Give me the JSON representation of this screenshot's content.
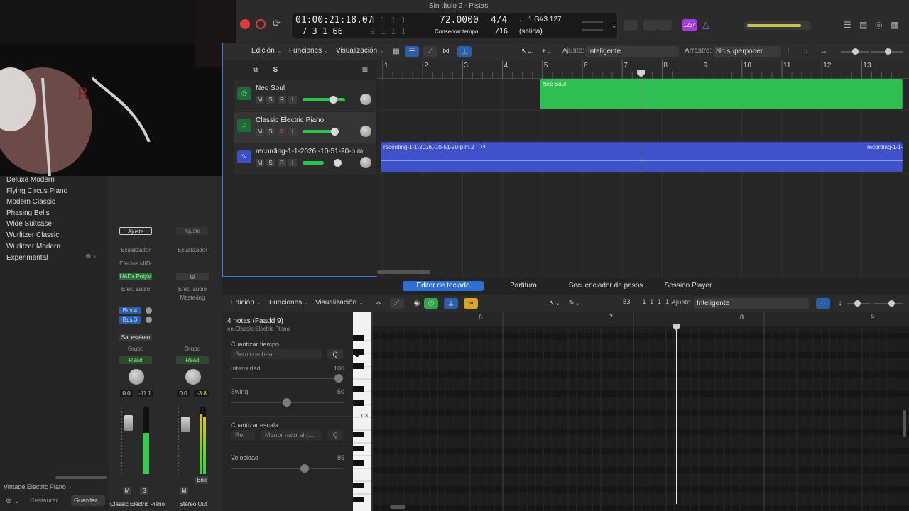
{
  "window": {
    "title": "Sin título 2 - Pistas"
  },
  "lcd": {
    "time": "01:00:21:18.07",
    "bars_dim": "1  1  1    1",
    "bars": "7  3  1    66",
    "bars2_dim": "9  1  1    1",
    "tempo": "72.0000",
    "tempo_mode": "Conservar tempo",
    "signature": "4/4",
    "division": "/16",
    "note": "♩ 1  G#3  127",
    "output": "(salida)",
    "count_in": "1234"
  },
  "library": {
    "items": [
      "Deluxe Modern",
      "Flying Circus Piano",
      "Modern Classic",
      "Phasing Bells",
      "Wide Suitcase",
      "Wurlitzer Classic",
      "Wurlitzer Modern",
      "Experimental"
    ],
    "patch": "Vintage Electric Piano",
    "restore": "Restaurar",
    "save": "Guardar..."
  },
  "mixer": {
    "strip1": {
      "setting": "Ajuste",
      "eq": "Ecualizador",
      "midi_fx": "Efectos MIDI",
      "plugin": "UADx PolyM",
      "audio_fx": "Efec. audio",
      "bus1": "Bus 4",
      "bus2": "Bus 3",
      "output": "Sal estéreo",
      "group": "Grupo",
      "auto": "Read",
      "pan": "0.0",
      "vol": "-11.1",
      "mute": "M",
      "solo": "S",
      "name": "Classic Electric Piano"
    },
    "strip2": {
      "setting": "Ajuste",
      "eq": "Ecualizador",
      "audio_fx": "Efec. audio",
      "mastering": "Mastering",
      "group": "Grupo",
      "auto": "Read",
      "pan": "0.0",
      "vol": "-3.8",
      "bnc": "Bnc",
      "mute": "M",
      "name": "Stereo Out"
    }
  },
  "track_toolbar": {
    "edit": "Edición",
    "functions": "Funciones",
    "view": "Visualización",
    "snap_label": "Ajuste:",
    "snap_value": "Inteligente",
    "drag_label": "Arrastre:",
    "drag_value": "No superponer"
  },
  "ruler": [
    "1",
    "2",
    "3",
    "4",
    "5",
    "6",
    "7",
    "8",
    "9",
    "10",
    "11",
    "12",
    "13"
  ],
  "tracks": [
    {
      "name": "Neo Soul",
      "m": "M",
      "s": "S",
      "r": "R",
      "i": "I"
    },
    {
      "name": "Classic Electric Piano",
      "m": "M",
      "s": "S",
      "r": "R",
      "i": "I"
    },
    {
      "name": "recording-1-1-2026,-10-51-20-p.m.",
      "m": "M",
      "s": "S",
      "r": "R",
      "i": "I"
    }
  ],
  "regions": {
    "neo": "Neo Soul",
    "audio": "recording-1-1-2026,-10-51-20-p.m.2",
    "audio2": "recording-1-1-"
  },
  "editor": {
    "tabs": [
      "Editor de teclado",
      "Partitura",
      "Secuenciador de pasos",
      "Session Player"
    ],
    "edit": "Edición",
    "functions": "Funciones",
    "view": "Visualización",
    "position": "B3   1 1 1 1",
    "snap_label": "Ajuste:",
    "snap_value": "Inteligente",
    "region_title": "4 notas (Faadd 9)",
    "region_sub": "en Classic Electric Piano",
    "quantize_time": "Cuantizar tiempo",
    "quantize_value": "Semicorchea",
    "q": "Q",
    "intensity": "Intensidad",
    "intensity_val": "100",
    "swing": "Swing",
    "swing_val": "50",
    "quantize_scale": "Cuantizar escala",
    "scale_root": "Re",
    "scale_type": "Menor natural (...",
    "velocity": "Velocidad",
    "velocity_val": "85",
    "c3": "C3",
    "ruler": [
      "6",
      "7",
      "8",
      "9"
    ]
  }
}
